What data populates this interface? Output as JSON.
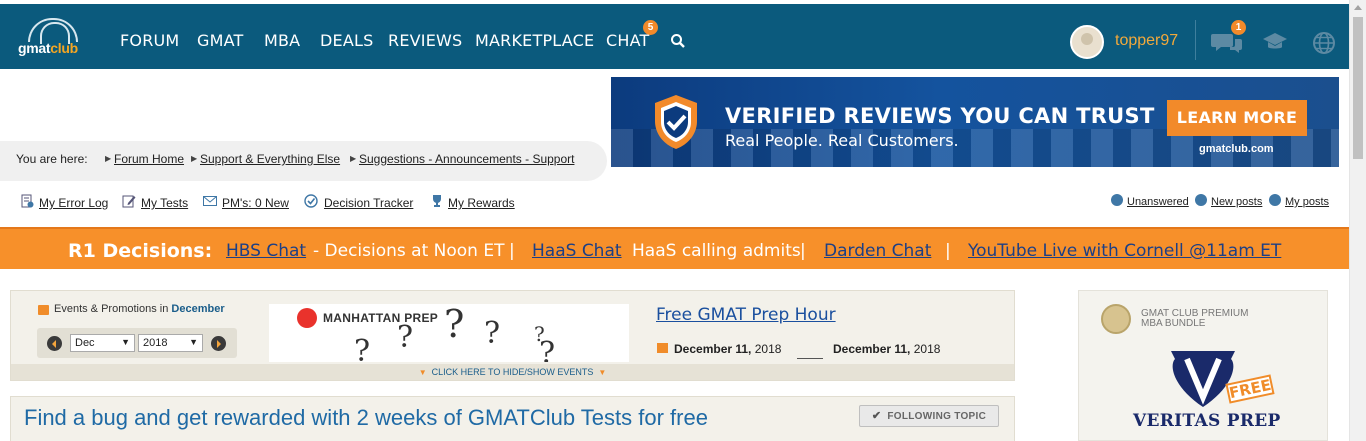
{
  "nav": {
    "logo_text_a": "gmat",
    "logo_text_b": "club",
    "items": [
      "FORUM",
      "GMAT",
      "MBA",
      "DEALS",
      "REVIEWS",
      "MARKETPLACE",
      "CHAT"
    ],
    "chat_badge": "5",
    "search_icon": "search-icon",
    "username": "topper97",
    "messages_badge": "1",
    "icons": [
      "chat-bubbles-icon",
      "graduation-cap-icon",
      "globe-icon"
    ]
  },
  "banner": {
    "headline": "VERIFIED REVIEWS YOU CAN TRUST",
    "subline": "Real People. Real Customers.",
    "button": "LEARN MORE",
    "site": "gmatclub.com"
  },
  "breadcrumb": {
    "prefix": "You are here:",
    "items": [
      "Forum Home",
      "Support & Everything Else",
      "Suggestions - Announcements - Support"
    ]
  },
  "quick_links": {
    "left": [
      "My Error Log",
      "My Tests",
      "PM's: 0 New",
      "Decision Tracker",
      "My Rewards"
    ],
    "right": [
      "Unanswered",
      "New posts",
      "My posts"
    ]
  },
  "decisions": {
    "label": "R1 Decisions:",
    "hbs": "HBS Chat",
    "hbs_note": "- Decisions at Noon ET",
    "sep": "|",
    "haas": "HaaS Chat",
    "haas_note": "HaaS calling admits",
    "darden": "Darden Chat",
    "youtube": "YouTube Live with Cornell @11am ET"
  },
  "events": {
    "title_prefix": "Events & Promotions in",
    "title_month": "December",
    "month_select": "Dec",
    "year_select": "2018",
    "promo_brand": "MANHATTAN PREP",
    "event_title": "Free GMAT Prep Hour",
    "start_date_bold": "December 11,",
    "start_year": "2018",
    "end_date_bold": "December 11,",
    "end_year": "2018",
    "toggle": "CLICK HERE TO HIDE/SHOW EVENTS"
  },
  "topic": {
    "title": "Find a bug and get rewarded with 2 weeks of GMATClub Tests for free",
    "follow_button": "FOLLOWING TOPIC"
  },
  "side_ad": {
    "line1": "GMAT CLUB PREMIUM",
    "line2": "MBA BUNDLE",
    "badge": "FREE",
    "brand": "VERITAS PREP"
  },
  "colors": {
    "nav_bg": "#0b5a7d",
    "accent_orange": "#f7902a",
    "link_blue": "#1c3f86"
  }
}
